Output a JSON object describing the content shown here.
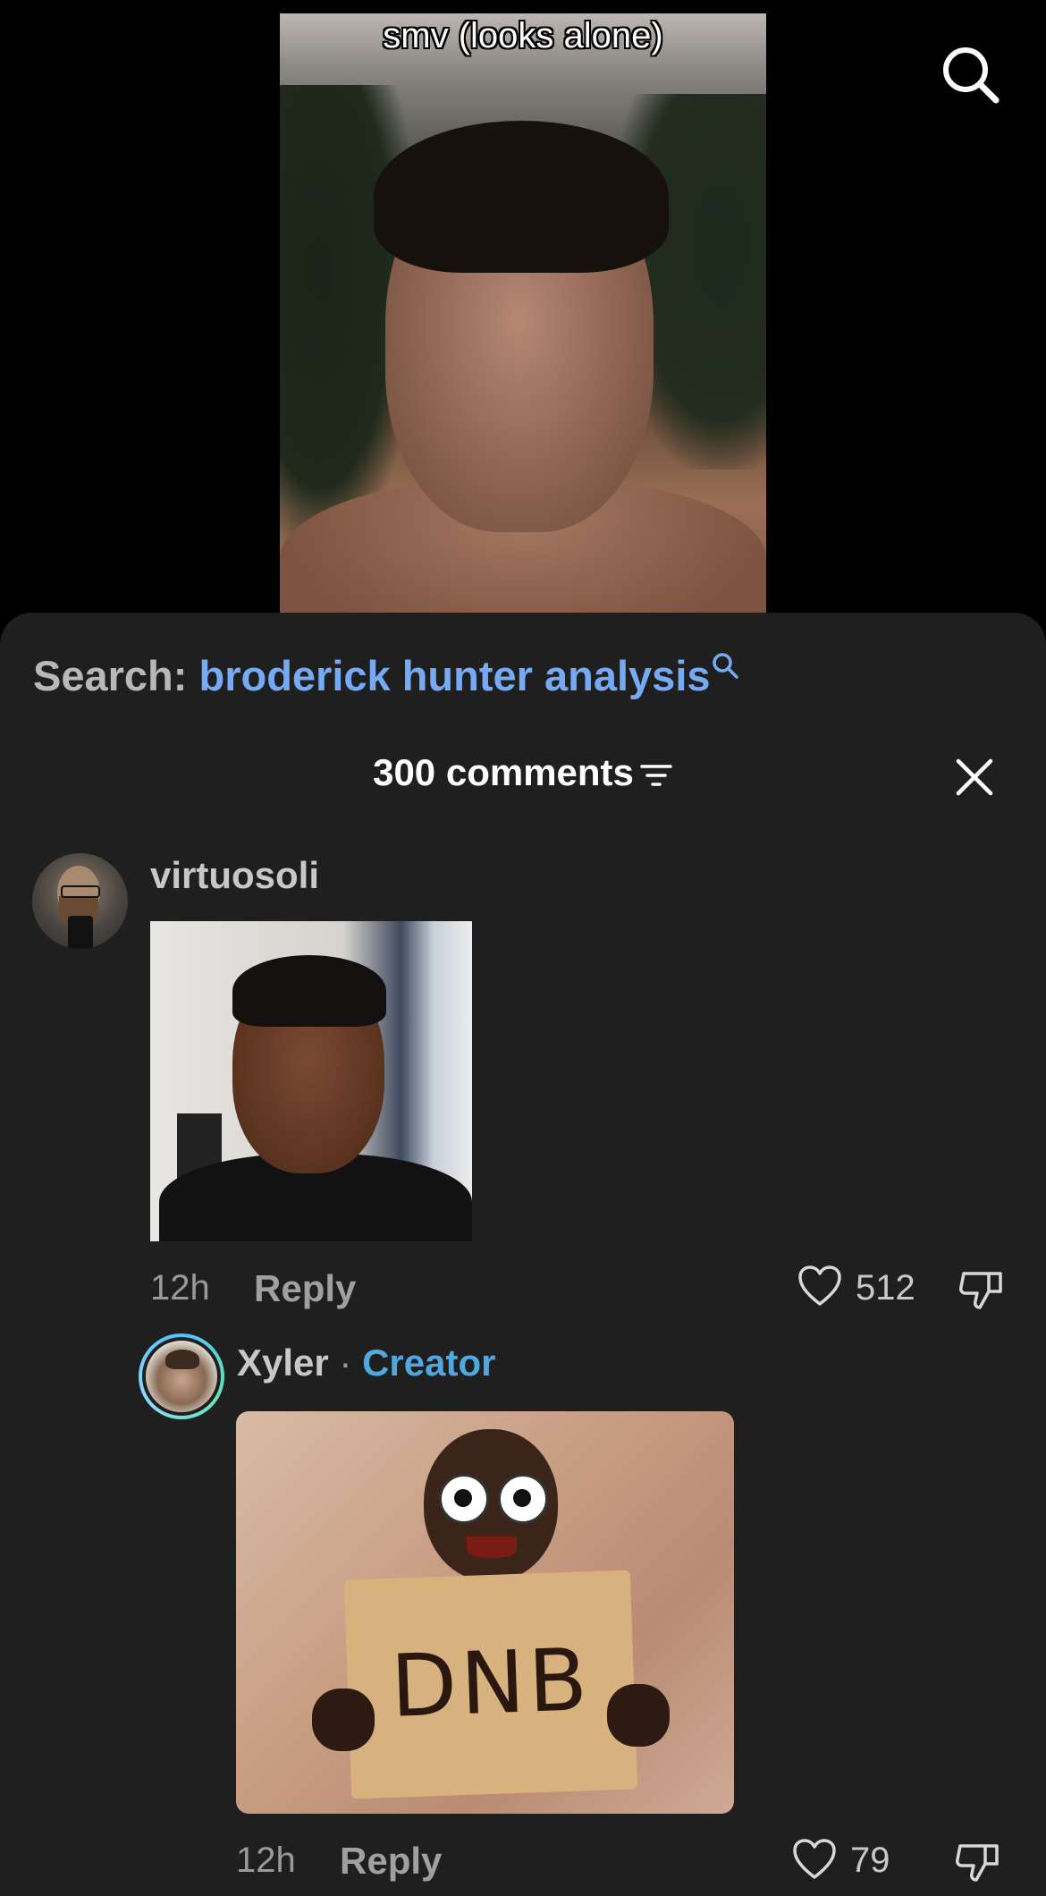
{
  "video": {
    "overlay_text": "smv (looks alone)"
  },
  "top_bar": {
    "search_icon": "search-icon"
  },
  "search": {
    "label": "Search:",
    "query": "broderick hunter analysis",
    "icon": "search-icon"
  },
  "comments_header": {
    "title": "300 comments",
    "filter_icon": "filter-icon",
    "close_icon": "close-icon"
  },
  "comments": [
    {
      "username": "virtuosoli",
      "time": "12h",
      "reply_label": "Reply",
      "likes": "512",
      "like_icon": "heart-icon",
      "dislike_icon": "dislike-icon"
    },
    {
      "username": "Xyler",
      "separator": "·",
      "badge": "Creator",
      "image_sign_text": "DNB",
      "time": "12h",
      "reply_label": "Reply",
      "likes": "79",
      "like_icon": "heart-icon",
      "dislike_icon": "dislike-icon"
    }
  ],
  "colors": {
    "sheet_bg": "#1f1f1f",
    "search_query": "#76aaf4",
    "creator_badge": "#4fa9e0"
  }
}
